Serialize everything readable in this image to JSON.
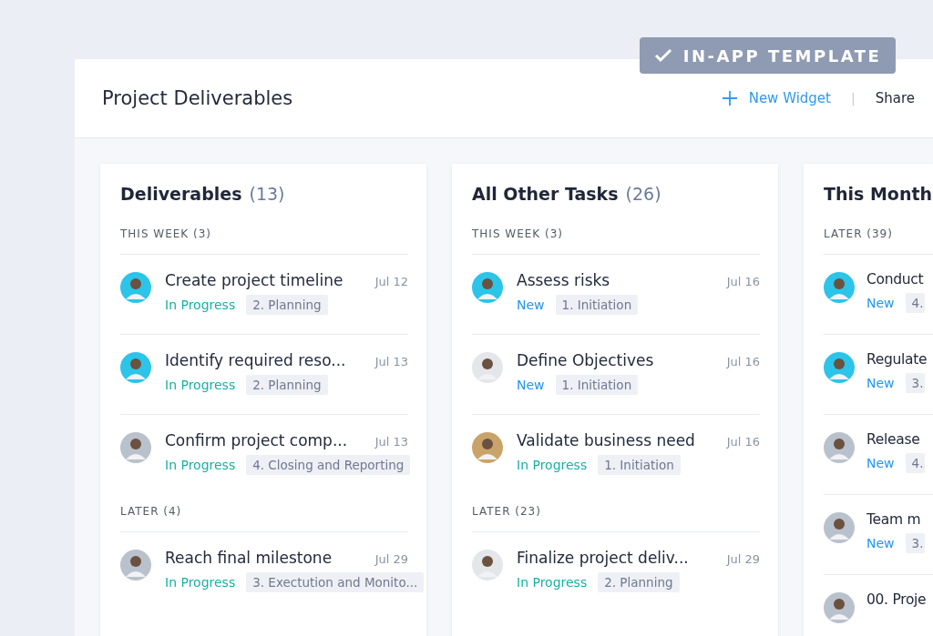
{
  "badge": {
    "label": "IN-APP TEMPLATE"
  },
  "header": {
    "title": "Project Deliverables",
    "new_widget": "New Widget",
    "separator": "|",
    "share": "Share"
  },
  "columns": [
    {
      "title": "Deliverables",
      "count": "(13)",
      "sections": [
        {
          "label": "THIS WEEK (3)",
          "tasks": [
            {
              "title": "Create project timeline",
              "date": "Jul 12",
              "status": "In Progress",
              "kind": "in_progress",
              "phase": "2. Planning",
              "color": "#2cc4e8"
            },
            {
              "title": "Identify required reso...",
              "date": "Jul 13",
              "status": "In Progress",
              "kind": "in_progress",
              "phase": "2. Planning",
              "color": "#2cc4e8"
            },
            {
              "title": "Confirm project comp...",
              "date": "Jul 13",
              "status": "In Progress",
              "kind": "in_progress",
              "phase": "4. Closing and Reporting",
              "color": "#b9c2cc"
            }
          ]
        },
        {
          "label": "LATER (4)",
          "tasks": [
            {
              "title": "Reach final milestone",
              "date": "Jul 29",
              "status": "In Progress",
              "kind": "in_progress",
              "phase": "3. Exectution and Monito...",
              "color": "#b9c2cc"
            }
          ]
        }
      ]
    },
    {
      "title": "All Other Tasks",
      "count": "(26)",
      "sections": [
        {
          "label": "THIS WEEK (3)",
          "tasks": [
            {
              "title": "Assess risks",
              "date": "Jul 16",
              "status": "New",
              "kind": "new",
              "phase": "1. Initiation",
              "color": "#2cc4e8"
            },
            {
              "title": "Define Objectives",
              "date": "Jul 16",
              "status": "New",
              "kind": "new",
              "phase": "1. Initiation",
              "color": "#e4e6ea"
            },
            {
              "title": "Validate business need",
              "date": "Jul 16",
              "status": "In Progress",
              "kind": "in_progress",
              "phase": "1. Initiation",
              "color": "#c9a46a"
            }
          ]
        },
        {
          "label": "LATER (23)",
          "tasks": [
            {
              "title": "Finalize project deliv...",
              "date": "Jul 29",
              "status": "In Progress",
              "kind": "in_progress",
              "phase": "2. Planning",
              "color": "#e4e6ea"
            }
          ]
        }
      ]
    },
    {
      "title": "This Month",
      "sections": [
        {
          "label": "LATER (39)",
          "tasks": [
            {
              "title": "Conduct",
              "status": "New",
              "kind": "new",
              "phase": "4.",
              "color": "#2cc4e8"
            },
            {
              "title": "Regulate",
              "status": "New",
              "kind": "new",
              "phase": "3.",
              "color": "#2cc4e8"
            },
            {
              "title": "Release",
              "status": "New",
              "kind": "new",
              "phase": "4.",
              "color": "#b9c2cc"
            },
            {
              "title": "Team m",
              "status": "New",
              "kind": "new",
              "phase": "3.",
              "color": "#b9c2cc"
            },
            {
              "title": "00. Proje",
              "color": "#b9c2cc"
            }
          ]
        }
      ]
    }
  ]
}
